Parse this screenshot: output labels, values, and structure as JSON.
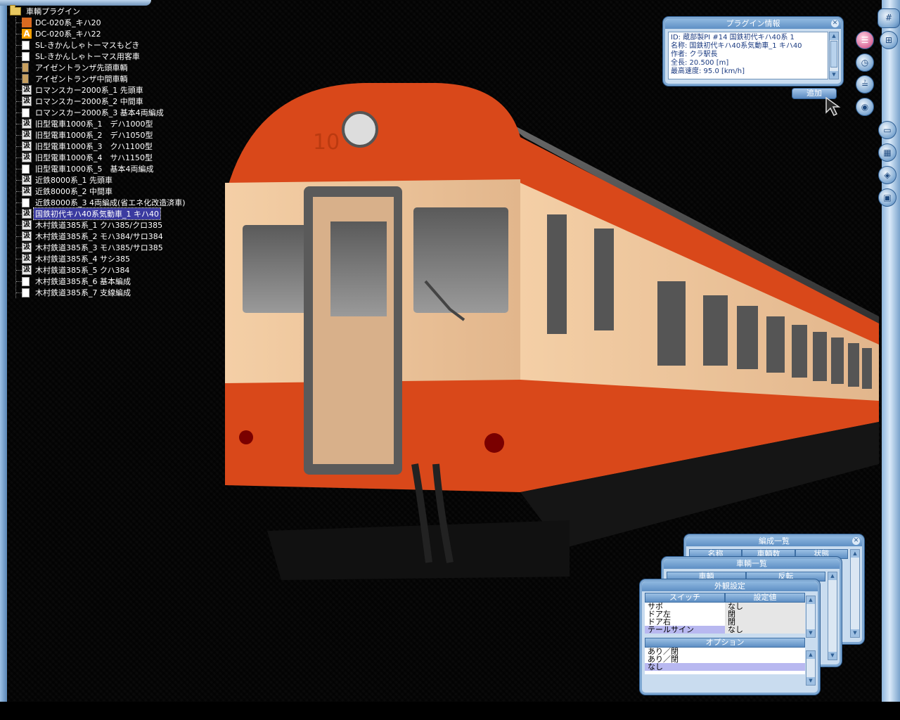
{
  "tree": {
    "root_label": "車輌プラグイン",
    "items": [
      {
        "label": "DC-020系_キハ20",
        "icon": "train"
      },
      {
        "label": "DC-020系_キハ22",
        "icon": "a"
      },
      {
        "label": "SL-きかんしゃトーマスもどき",
        "icon": "page"
      },
      {
        "label": "SL-きかんしゃトーマス用客車",
        "icon": "page"
      },
      {
        "label": "アイゼントランザ先頭車輌",
        "icon": "door"
      },
      {
        "label": "アイゼントランザ中間車輌",
        "icon": "door"
      },
      {
        "label": "ロマンスカー2000系_1 先頭車",
        "icon": "kanji"
      },
      {
        "label": "ロマンスカー2000系_2 中間車",
        "icon": "kanji"
      },
      {
        "label": "ロマンスカー2000系_3 基本4両編成",
        "icon": "page"
      },
      {
        "label": "旧型電車1000系_1　デハ1000型",
        "icon": "kanji"
      },
      {
        "label": "旧型電車1000系_2　デハ1050型",
        "icon": "kanji"
      },
      {
        "label": "旧型電車1000系_3　クハ1100型",
        "icon": "kanji"
      },
      {
        "label": "旧型電車1000系_4　サハ1150型",
        "icon": "kanji"
      },
      {
        "label": "旧型電車1000系_5　基本4両編成",
        "icon": "page"
      },
      {
        "label": "近鉄8000系_1 先頭車",
        "icon": "kanji"
      },
      {
        "label": "近鉄8000系_2 中間車",
        "icon": "kanji"
      },
      {
        "label": "近鉄8000系_3 4両編成(省エネ化改造済車)",
        "icon": "page"
      },
      {
        "label": "国鉄初代キハ40系気動車_1 キハ40",
        "icon": "kanji",
        "selected": true
      },
      {
        "label": "木村鉄道385系_1 クハ385/クロ385",
        "icon": "kanji"
      },
      {
        "label": "木村鉄道385系_2 モハ384/サロ384",
        "icon": "kanji"
      },
      {
        "label": "木村鉄道385系_3 モハ385/サロ385",
        "icon": "kanji"
      },
      {
        "label": "木村鉄道385系_4 サシ385",
        "icon": "kanji"
      },
      {
        "label": "木村鉄道385系_5 クハ384",
        "icon": "kanji"
      },
      {
        "label": "木村鉄道385系_6 基本編成",
        "icon": "page"
      },
      {
        "label": "木村鉄道385系_7 支線編成",
        "icon": "page"
      }
    ],
    "kanji_glyph": "汲",
    "a_glyph": "A"
  },
  "plugin_info": {
    "title": "プラグイン情報",
    "lines": [
      "ID: 蔵部製PI #14 国鉄初代キハ40系 1",
      "名称: 国鉄初代キハ40系気動車_1 キハ40",
      "作者: クラ駅長",
      "全長: 20.500 [m]",
      "最高速度: 95.0 [km/h]"
    ],
    "add_label": "追加"
  },
  "train_number": "10",
  "formation_list": {
    "title": "編成一覧",
    "columns": [
      "名称",
      "車輌数",
      "状態"
    ]
  },
  "vehicle_list": {
    "title": "車輌一覧",
    "columns": [
      "車輌",
      "反転"
    ]
  },
  "appearance": {
    "title": "外観設定",
    "columns": [
      "スイッチ",
      "設定値"
    ],
    "rows": [
      {
        "switch": "サボ",
        "value": "なし"
      },
      {
        "switch": "ドア左",
        "value": "閉"
      },
      {
        "switch": "ドア右",
        "value": "閉"
      },
      {
        "switch": "テールサイン",
        "value": "なし"
      }
    ],
    "options_title": "オプション",
    "options": [
      "あり／閉",
      "あり／閉",
      "なし"
    ]
  },
  "toolbar": {
    "top_icon": "#",
    "buttons": [
      "grid-icon",
      "layout-icon",
      "clock-icon",
      "rail-icon",
      "eye-icon",
      "train-icon",
      "building-icon",
      "layers-icon",
      "computer-icon"
    ]
  },
  "colors": {
    "accent": "#7fa8d2",
    "train_orange": "#d9481a",
    "train_cream": "#f0c9a0"
  }
}
